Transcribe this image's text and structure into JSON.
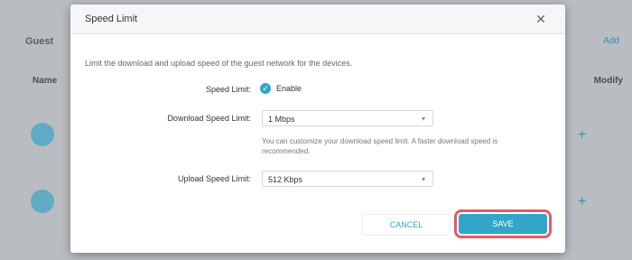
{
  "background": {
    "title": "Guest",
    "link": "Add",
    "column_left": "Name",
    "column_right": "Modify"
  },
  "modal": {
    "title": "Speed Limit",
    "close_glyph": "✕",
    "description": "Limit the download and upload speed of the guest network for the devices.",
    "speed_limit": {
      "label": "Speed Limit:",
      "checkbox_label": "Enable",
      "checked": true
    },
    "download": {
      "label": "Download Speed Limit:",
      "value": "1 Mbps"
    },
    "download_hint": "You can customize your download speed limit. A faster download speed is recommended.",
    "upload": {
      "label": "Upload Speed Limit:",
      "value": "512 Kbps"
    },
    "cancel_label": "CANCEL",
    "save_label": "SAVE"
  },
  "colors": {
    "accent": "#32a6c9",
    "highlight": "#e25b68"
  },
  "icons": [
    "close-icon",
    "check-icon",
    "chevron-down-icon",
    "plus-icon",
    "device-icon"
  ]
}
